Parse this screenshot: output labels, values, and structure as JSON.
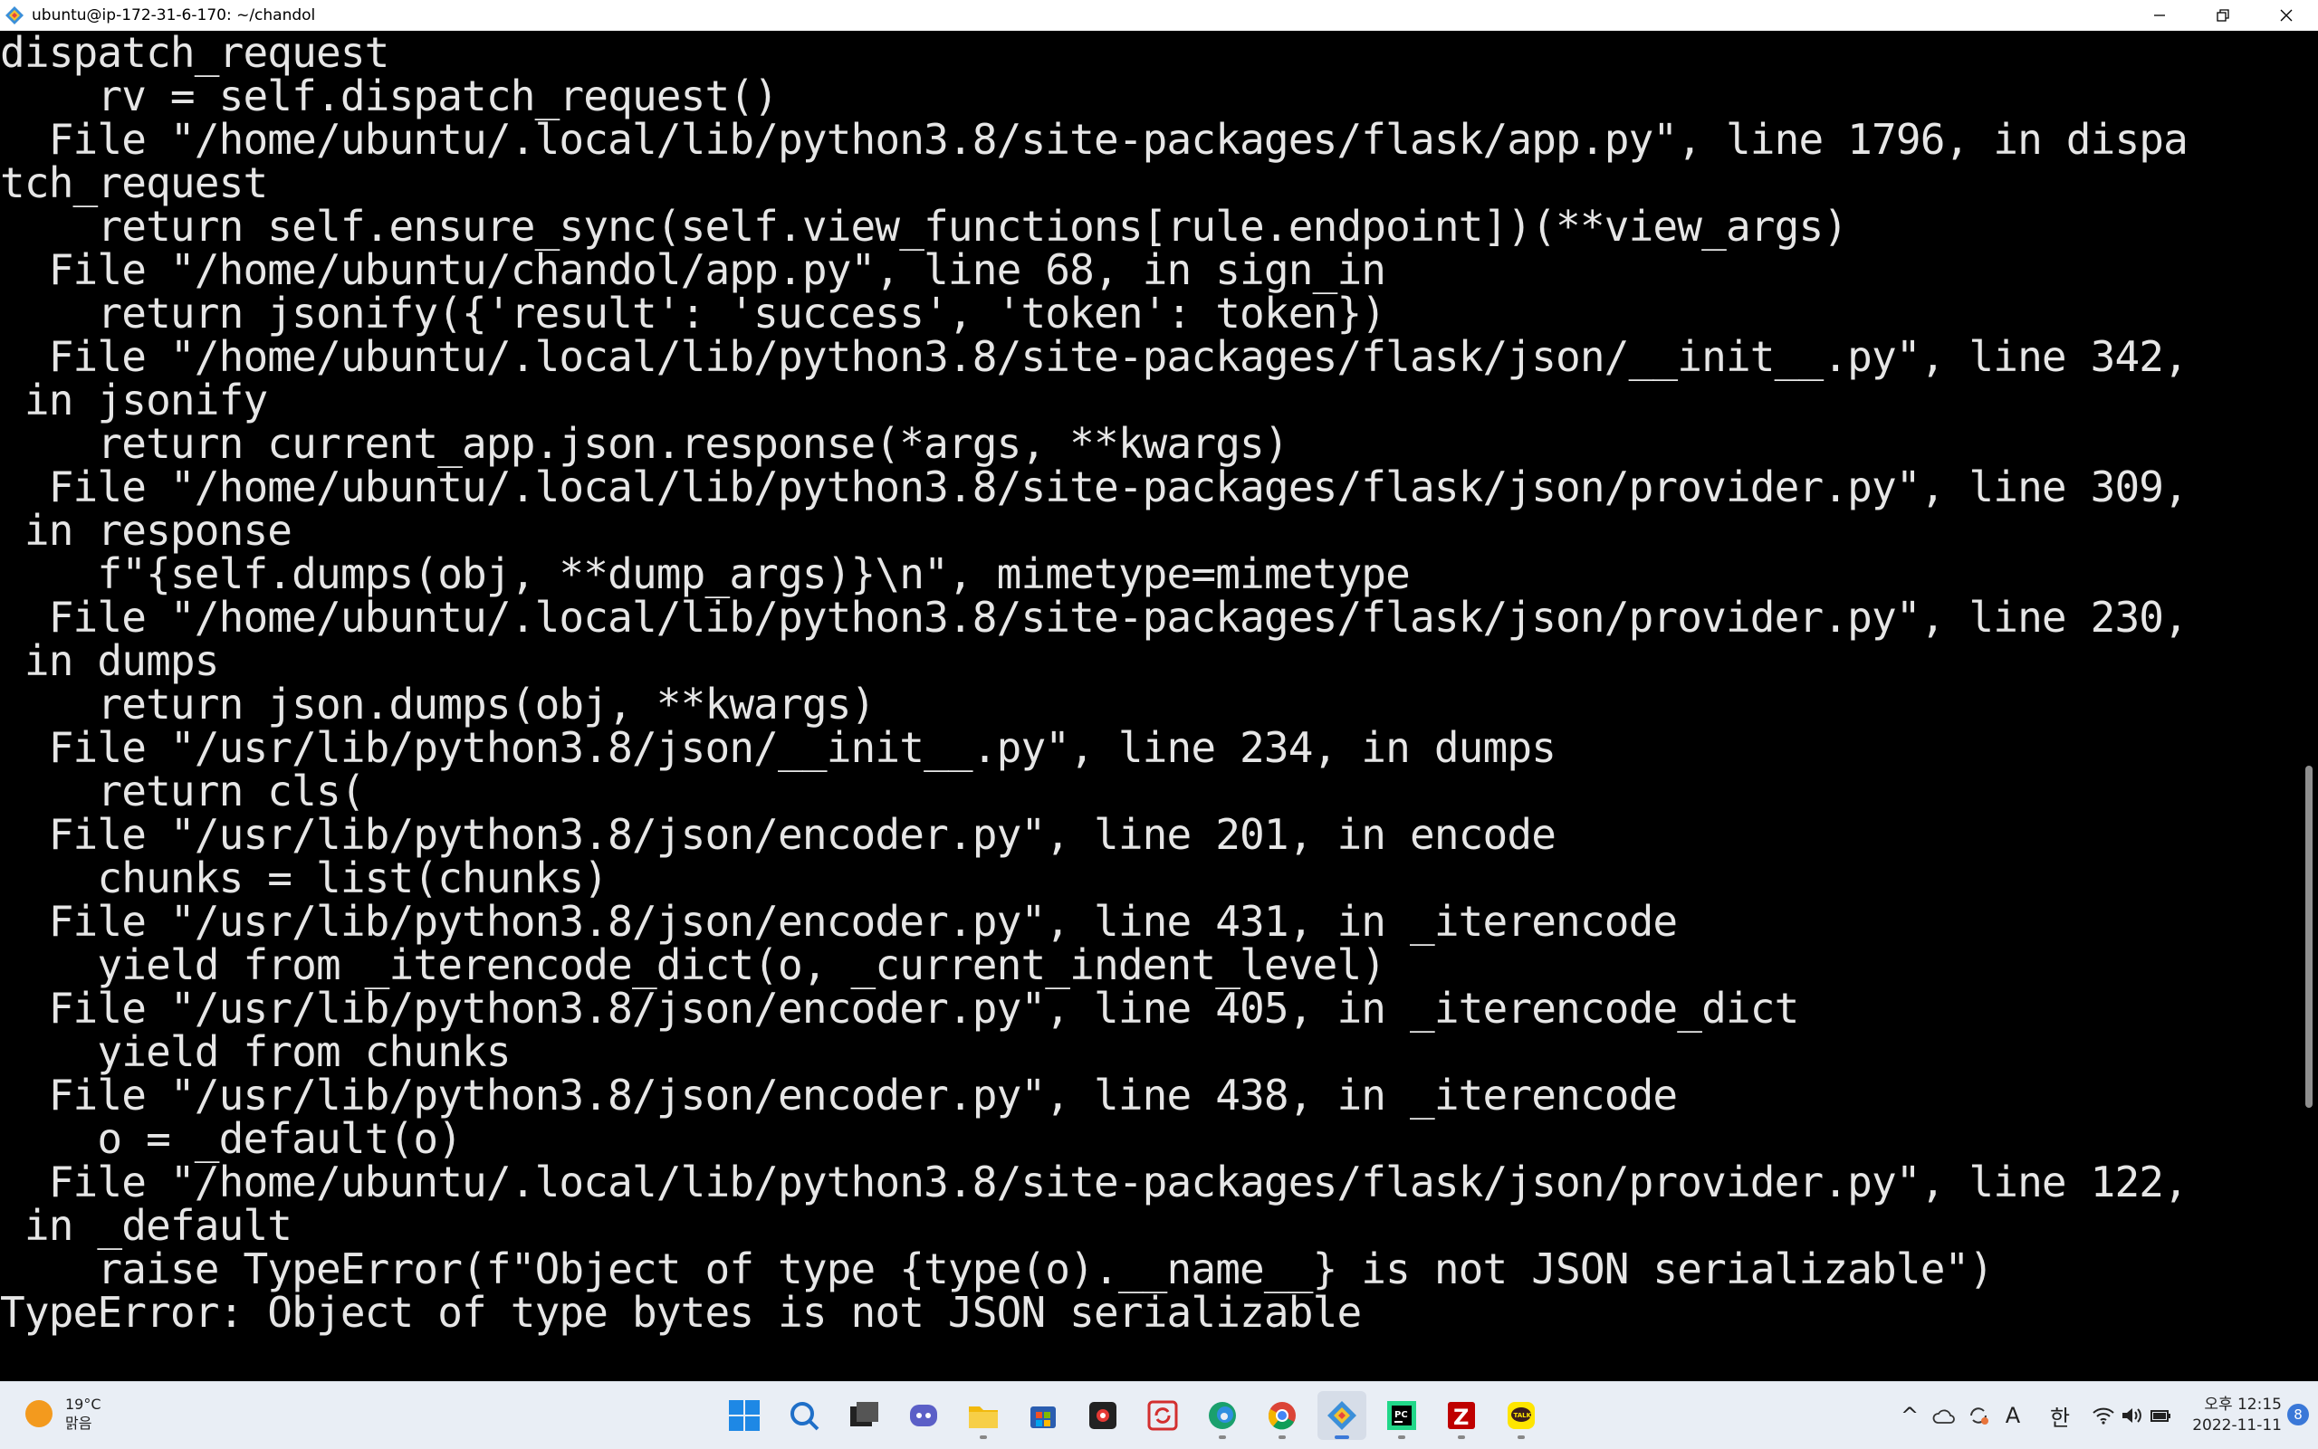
{
  "window": {
    "title": "ubuntu@ip-172-31-6-170: ~/chandol"
  },
  "terminal": {
    "lines": [
      "dispatch_request",
      "    rv = self.dispatch_request()",
      "  File \"/home/ubuntu/.local/lib/python3.8/site-packages/flask/app.py\", line 1796, in dispa",
      "tch_request",
      "    return self.ensure_sync(self.view_functions[rule.endpoint])(**view_args)",
      "  File \"/home/ubuntu/chandol/app.py\", line 68, in sign_in",
      "    return jsonify({'result': 'success', 'token': token})",
      "  File \"/home/ubuntu/.local/lib/python3.8/site-packages/flask/json/__init__.py\", line 342,",
      " in jsonify",
      "    return current_app.json.response(*args, **kwargs)",
      "  File \"/home/ubuntu/.local/lib/python3.8/site-packages/flask/json/provider.py\", line 309,",
      " in response",
      "    f\"{self.dumps(obj, **dump_args)}\\n\", mimetype=mimetype",
      "  File \"/home/ubuntu/.local/lib/python3.8/site-packages/flask/json/provider.py\", line 230,",
      " in dumps",
      "    return json.dumps(obj, **kwargs)",
      "  File \"/usr/lib/python3.8/json/__init__.py\", line 234, in dumps",
      "    return cls(",
      "  File \"/usr/lib/python3.8/json/encoder.py\", line 201, in encode",
      "    chunks = list(chunks)",
      "  File \"/usr/lib/python3.8/json/encoder.py\", line 431, in _iterencode",
      "    yield from _iterencode_dict(o, _current_indent_level)",
      "  File \"/usr/lib/python3.8/json/encoder.py\", line 405, in _iterencode_dict",
      "    yield from chunks",
      "  File \"/usr/lib/python3.8/json/encoder.py\", line 438, in _iterencode",
      "    o = _default(o)",
      "  File \"/home/ubuntu/.local/lib/python3.8/site-packages/flask/json/provider.py\", line 122,",
      " in _default",
      "    raise TypeError(f\"Object of type {type(o).__name__} is not JSON serializable\")",
      "TypeError: Object of type bytes is not JSON serializable",
      ""
    ]
  },
  "taskbar": {
    "weather": {
      "temp": "19°C",
      "condition": "맑음",
      "icon": "sun-icon"
    },
    "pinned_apps": [
      {
        "name": "start-button",
        "icon": "windows-logo-icon",
        "active": false
      },
      {
        "name": "search-button",
        "icon": "search-icon",
        "active": false
      },
      {
        "name": "task-view-button",
        "icon": "task-view-icon",
        "active": false
      },
      {
        "name": "chat-app",
        "icon": "chat-icon",
        "active": false
      },
      {
        "name": "file-explorer-app",
        "icon": "folder-icon",
        "active": false
      },
      {
        "name": "store-app",
        "icon": "store-icon",
        "active": false
      },
      {
        "name": "capture-app",
        "icon": "capture-icon",
        "active": false
      },
      {
        "name": "sync-app",
        "icon": "sync-icon",
        "active": false
      },
      {
        "name": "edge-app",
        "icon": "edge-icon",
        "active": false
      },
      {
        "name": "chrome-app",
        "icon": "chrome-icon",
        "active": false
      },
      {
        "name": "terminal-app",
        "icon": "terminal-icon",
        "active": true
      },
      {
        "name": "pycharm-app",
        "icon": "pycharm-icon",
        "active": false
      },
      {
        "name": "filezilla-app",
        "icon": "filezilla-icon",
        "active": false
      },
      {
        "name": "kakaotalk-app",
        "icon": "kakaotalk-icon",
        "active": false
      }
    ],
    "tray": {
      "chevron": "^",
      "ime_mode": "A",
      "ime_lang": "한"
    },
    "clock": {
      "time": "오후 12:15",
      "date": "2022-11-11"
    },
    "notification_count": "8"
  },
  "colors": {
    "terminal_bg": "#000000",
    "terminal_fg": "#e6e6e6",
    "taskbar_bg": "#e9eef5",
    "accent": "#3a78d8"
  }
}
